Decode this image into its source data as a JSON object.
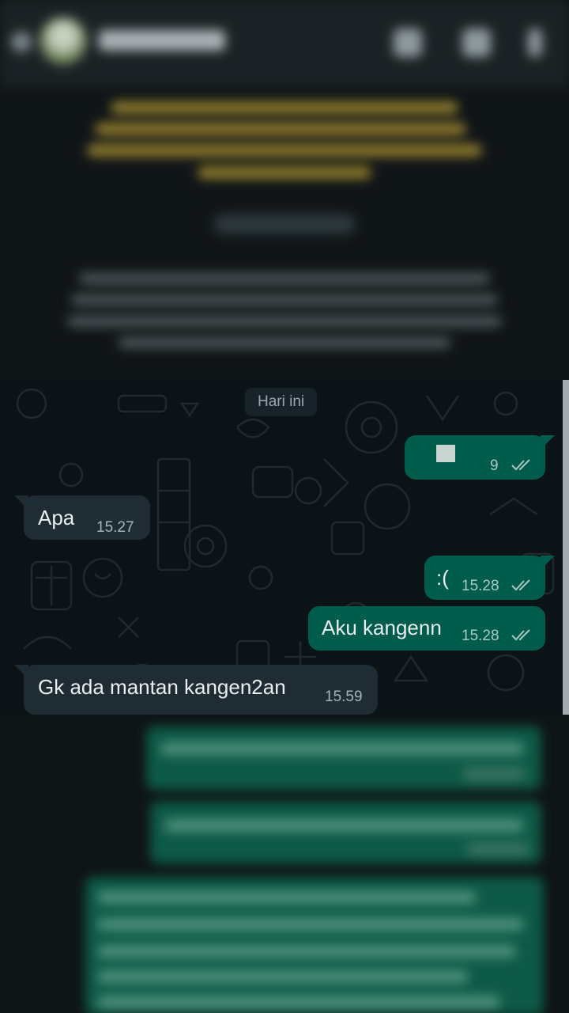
{
  "chat": {
    "day_label": "Hari ini",
    "messages": [
      {
        "side": "out",
        "text": "",
        "time": "9",
        "read": true,
        "has_image_thumb": true
      },
      {
        "side": "in",
        "text": "Apa",
        "time": "15.27"
      },
      {
        "side": "out",
        "text": ":(",
        "time": "15.28",
        "read": true
      },
      {
        "side": "out",
        "text": "Aku kangenn",
        "time": "15.28",
        "read": true
      },
      {
        "side": "in",
        "text": "Gk ada mantan kangen2an",
        "time": "15.59"
      }
    ]
  },
  "colors": {
    "outgoing_bubble": "#005c4b",
    "incoming_bubble": "#202c33",
    "chat_background": "#0c1317",
    "read_ticks": "#a8c8c0"
  },
  "icons": [
    "back-arrow-icon",
    "video-call-icon",
    "phone-icon",
    "more-options-icon",
    "double-check-icon"
  ]
}
